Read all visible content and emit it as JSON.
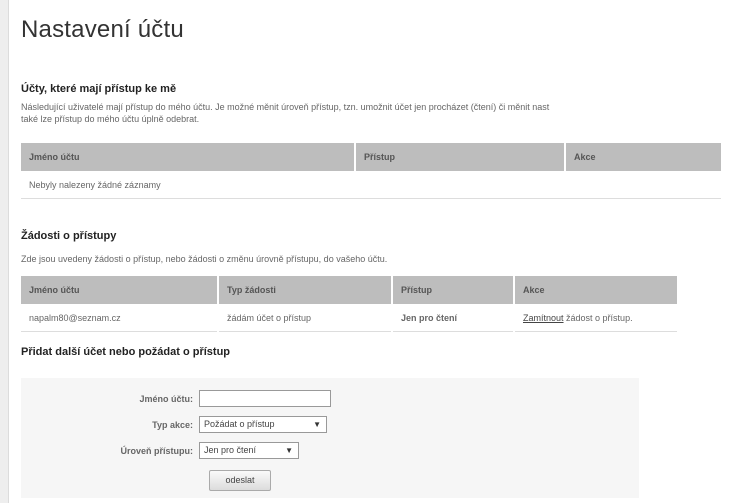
{
  "page": {
    "title": "Nastavení účtu"
  },
  "access_section": {
    "title": "Účty, které mají přístup ke mě",
    "description_line1": "Následující uživatelé mají přístup do mého účtu. Je možné měnit úroveň přístup, tzn. umožnit účet jen procházet (čtení) či měnit nast",
    "description_line2": "také lze přístup do mého účtu úplně odebrat.",
    "columns": [
      "Jméno účtu",
      "Přístup",
      "Akce"
    ],
    "empty_message": "Nebyly nalezeny žádné záznamy"
  },
  "requests_section": {
    "title": "Žádosti o přístupy",
    "description": "Zde jsou uvedeny žádosti o přístup, nebo žádosti o změnu úrovně přístupu, do vašeho účtu.",
    "columns": [
      "Jméno účtu",
      "Typ žádosti",
      "Přístup",
      "Akce"
    ],
    "rows": [
      {
        "account": "napalm80@seznam.cz",
        "request_type": "žádám účet o přístup",
        "access": "Jen pro čtení",
        "action_link": "Zamítnout",
        "action_text": " žádost o přístup."
      }
    ]
  },
  "add_section": {
    "title": "Přidat další účet nebo požádat o přístup",
    "account_label": "Jméno účtu:",
    "account_value": "",
    "action_type_label": "Typ akce:",
    "action_type_value": "Požádat o přístup",
    "access_level_label": "Úroveň přístupu:",
    "access_level_value": "Jen pro čtení",
    "submit_label": "odeslat"
  }
}
